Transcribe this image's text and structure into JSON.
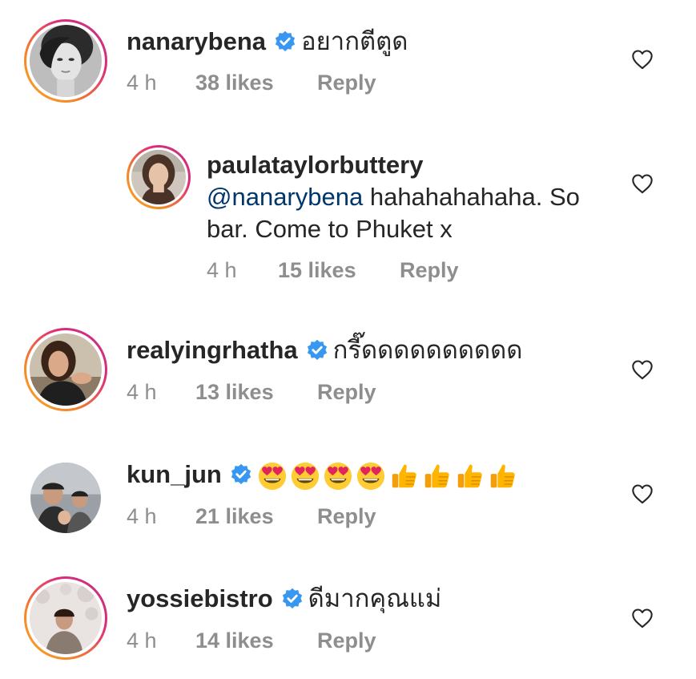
{
  "comments": [
    {
      "username": "nanarybena",
      "verified": true,
      "text": "อยากตีตูด",
      "time": "4 h",
      "likes": "38 likes",
      "reply": "Reply"
    },
    {
      "username": "paulataylorbuttery",
      "verified": false,
      "mention": "@nanarybena",
      "text_line1": " hahahahahaha. So",
      "text_line2": "bar. Come to Phuket x",
      "time": "4 h",
      "likes": "15 likes",
      "reply": "Reply"
    },
    {
      "username": "realyingrhatha",
      "verified": true,
      "text": "กรี๊ดดดดดดดดดด",
      "time": "4 h",
      "likes": "13 likes",
      "reply": "Reply"
    },
    {
      "username": "kun_jun",
      "verified": true,
      "emojis": [
        "heart-eyes-emoji",
        "heart-eyes-emoji",
        "heart-eyes-emoji",
        "heart-eyes-emoji",
        "thumbs-up-emoji",
        "thumbs-up-emoji",
        "thumbs-up-emoji",
        "thumbs-up-emoji"
      ],
      "time": "4 h",
      "likes": "21 likes",
      "reply": "Reply"
    },
    {
      "username": "yossiebistro",
      "verified": true,
      "text": "ดีมากคุณแม่",
      "time": "4 h",
      "likes": "14 likes",
      "reply": "Reply"
    }
  ],
  "colors": {
    "verified_blue": "#3897f0",
    "mention_blue": "#00376b",
    "meta_gray": "#8e8e8e",
    "story_ring": "#dd2a7b",
    "emoji_yellow": "#ffcc33",
    "emoji_heart": "#e0245e"
  }
}
